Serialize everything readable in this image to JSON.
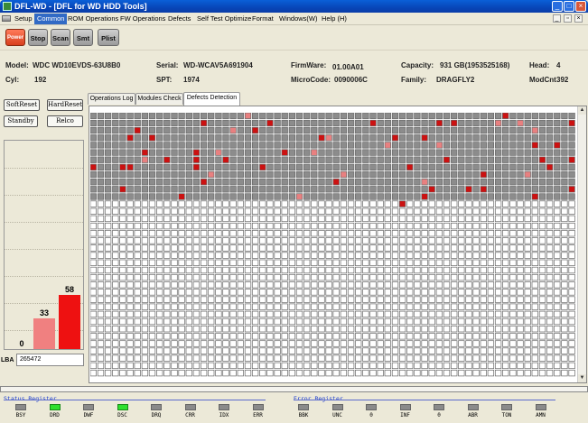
{
  "window": {
    "title": "DFL-WD - [DFL for WD HDD Tools]",
    "minimize": "_",
    "maximize": "□",
    "close": "×"
  },
  "menu": [
    "Setup",
    "Common",
    "ROM Operations",
    "FW Operations",
    "Defects",
    "Self Test Optimize",
    "Format",
    "Windows(W)",
    "Help (H)"
  ],
  "menu_active": "Common",
  "toolbar": [
    "Power",
    "Stop",
    "Scan",
    "Smt",
    "Plist"
  ],
  "drive": {
    "model_label": "Model:",
    "model": "WDC WD10EVDS-63U8B0",
    "serial_label": "Serial:",
    "serial": "WD-WCAV5A691904",
    "firmware_label": "FirmWare:",
    "firmware": "01.00A01",
    "capacity_label": "Capacity:",
    "capacity": "931 GB(1953525168)",
    "head_label": "Head:",
    "head": "4",
    "cyl_label": "Cyl:",
    "cyl": "192",
    "spt_label": "SPT:",
    "spt": "1974",
    "microcode_label": "MicroCode:",
    "microcode": "0090006C",
    "family_label": "Family:",
    "family": "DRAGFLY2",
    "modcnt_label": "ModCnt",
    "modcnt": "392"
  },
  "side_buttons": {
    "soft_reset": "SoftReset",
    "hard_reset": "HardReset",
    "standby": "Standby",
    "relco": "Relco"
  },
  "graph": {
    "bars": [
      {
        "value": 0,
        "label": "0"
      },
      {
        "value": 33,
        "label": "33",
        "color": "#f08080"
      },
      {
        "value": 58,
        "label": "58",
        "color": "#ee1111"
      }
    ],
    "max": 58
  },
  "lba": {
    "label": "LBA",
    "value": "265472"
  },
  "tabs": [
    "Operations Log",
    "Modules Check",
    "Defects Detection"
  ],
  "selected_tab": "Defects Detection",
  "scan_grid": {
    "columns": 66,
    "rows": 36,
    "scanned_rows": 12
  },
  "status_register": {
    "title": "Status Register",
    "flags": [
      {
        "name": "BSY",
        "on": false
      },
      {
        "name": "DRD",
        "on": true
      },
      {
        "name": "DWF",
        "on": false
      },
      {
        "name": "DSC",
        "on": true
      },
      {
        "name": "DRQ",
        "on": false
      },
      {
        "name": "CRR",
        "on": false
      },
      {
        "name": "IDX",
        "on": false
      },
      {
        "name": "ERR",
        "on": false
      }
    ]
  },
  "error_register": {
    "title": "Error Register",
    "flags": [
      {
        "name": "BBK",
        "on": false
      },
      {
        "name": "UNC",
        "on": false
      },
      {
        "name": "0",
        "on": false
      },
      {
        "name": "INF",
        "on": false
      },
      {
        "name": "0",
        "on": false
      },
      {
        "name": "ABR",
        "on": false
      },
      {
        "name": "TON",
        "on": false
      },
      {
        "name": "AMN",
        "on": false
      }
    ]
  },
  "colors": {
    "scanned": "#8c8c8c",
    "defect": "#cc1111",
    "slow": "#e88080",
    "empty": "#ffffff",
    "led_on": "#2ee02e"
  },
  "icons": {
    "app": "app-icon",
    "menu": "window-menu-icon",
    "scroll_up": "scroll-up-icon",
    "scroll_down": "scroll-down-icon"
  }
}
